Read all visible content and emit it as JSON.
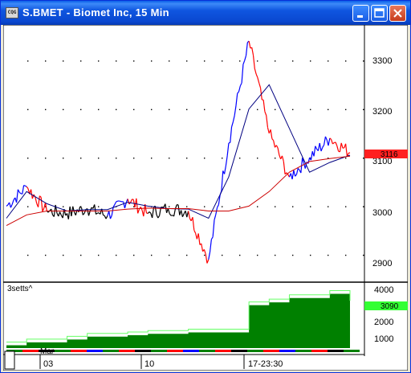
{
  "window": {
    "title": "S.BMET - Biomet Inc, 15 Min",
    "app_icon_text": "CQG",
    "buttons": [
      "minimize",
      "maximize",
      "close"
    ]
  },
  "price_panel": {
    "y_ticks": [
      "3300",
      "3200",
      "3100",
      "3000",
      "2900"
    ],
    "last_price": "3116",
    "last_price_color": "#ff2020"
  },
  "indicator_panel": {
    "label": "3setts^",
    "y_ticks": [
      "4000",
      "3000",
      "2000",
      "1000"
    ],
    "last_value": "3090",
    "last_value_color": "#33ff33",
    "fill_color": "#008000"
  },
  "time_axis": {
    "month_label": "Mar",
    "labels": [
      "03",
      "10",
      "17-23:30"
    ]
  },
  "colors": {
    "up_segment": "#0000ff",
    "down_segment": "#ff0000",
    "neutral_segment": "#000000",
    "ma_fast": "#000080",
    "ma_slow": "#cc0000"
  },
  "chart_data": [
    {
      "type": "line",
      "title": "",
      "xlabel": "",
      "ylabel": "",
      "ylim": [
        2860,
        3360
      ],
      "x": [
        "03",
        "",
        "",
        "",
        "",
        "",
        "10",
        "",
        "",
        "",
        "",
        "",
        "17-23:30",
        "",
        "",
        "",
        "",
        ""
      ],
      "series": [
        {
          "values": [
            3000,
            3040,
            2990,
            2985,
            2995,
            2980,
            3015,
            2985,
            2995,
            2990,
            2890,
            3130,
            3340,
            3150,
            3060,
            3100,
            3140,
            3110
          ]
        },
        {
          "values": [
            2975,
            3030,
            3005,
            2990,
            2993,
            2993,
            3008,
            3000,
            2995,
            2994,
            2975,
            3060,
            3200,
            3250,
            3160,
            3070,
            3090,
            3105
          ]
        },
        {
          "values": [
            2960,
            2982,
            2990,
            2990,
            2990,
            2990,
            2994,
            2996,
            2995,
            2995,
            2990,
            2990,
            3000,
            3030,
            3070,
            3092,
            3098,
            3103
          ]
        }
      ]
    },
    {
      "type": "area",
      "title": "",
      "ylim": [
        0,
        4500
      ],
      "values": [
        200,
        400,
        400,
        600,
        800,
        800,
        900,
        1000,
        1000,
        1100,
        1100,
        1100,
        3000,
        3200,
        3500,
        3500,
        3800,
        3090
      ]
    }
  ]
}
